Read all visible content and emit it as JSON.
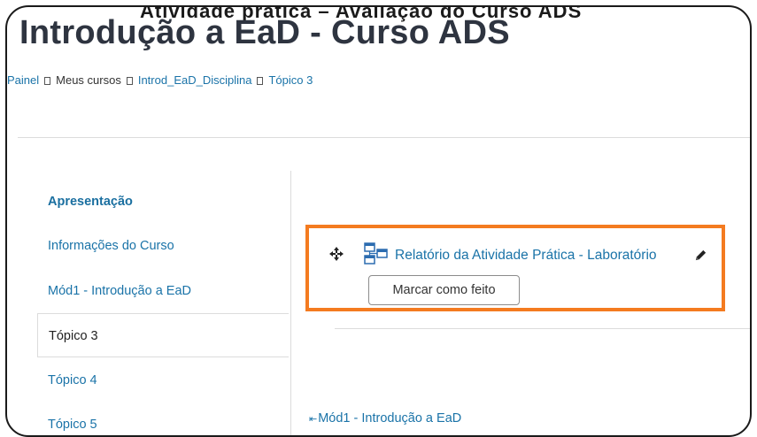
{
  "page": {
    "top_clipped_text": "Atividade prática – Avaliação do Curso ADS",
    "title": "Introdução a EaD - Curso ADS"
  },
  "breadcrumb": {
    "items": [
      "Painel",
      "Meus cursos",
      "Introd_EaD_Disciplina",
      "Tópico 3"
    ]
  },
  "sidebar": {
    "items": [
      {
        "label": "Apresentação"
      },
      {
        "label": "Informações do Curso"
      },
      {
        "label": "Mód1 - Introdução a EaD"
      },
      {
        "label": "Tópico 3"
      },
      {
        "label": "Tópico 4"
      },
      {
        "label": "Tópico 5"
      }
    ],
    "active_item": "Tópico 3"
  },
  "activity": {
    "title": "Relatório da Atividade Prática - Laboratório",
    "icon": "folder-tree-icon",
    "mark_done_label": "Marcar como feito"
  },
  "nav": {
    "prev_arrow": "⇤",
    "prev_label": "Mód1 - Introdução a EaD"
  },
  "colors": {
    "link": "#1a73a8",
    "highlight": "#f47b20",
    "title": "#2e3440"
  }
}
